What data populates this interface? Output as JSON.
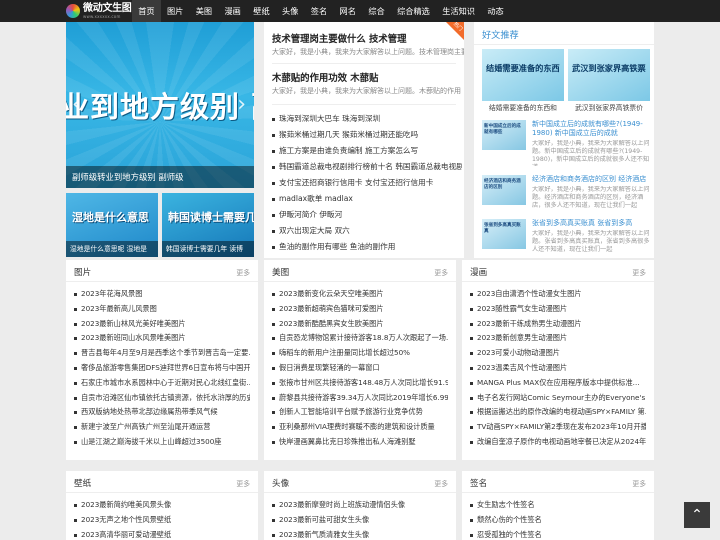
{
  "logo": {
    "title": "微动文生图网",
    "sub": "www.xxxxxx.com"
  },
  "nav": [
    "首页",
    "图片",
    "美图",
    "漫画",
    "壁纸",
    "头像",
    "签名",
    "网名",
    "综合",
    "综合精选",
    "生活知识",
    "动态"
  ],
  "slider": {
    "big_text": "业到地方级别 副",
    "caption": "副师级转业到地方级别 副师级"
  },
  "thumbs": [
    {
      "big": "湿地是什么意思",
      "caption": "湿地是什么意思呢 湿地是"
    },
    {
      "big": "韩国读博士需要几",
      "caption": "韩国读博士需要几年 读博"
    }
  ],
  "mid": {
    "corner_label": "热门",
    "headline1": "技术管理岗主要做什么 技术管理",
    "summary1": "大家好，我是小典，我来为大家解答以上问题。技术管理岗主要",
    "headline2": "木蔀贴的作用功效 木蔀贴",
    "summary2": "大家好，我是小典，我来为大家解答以上问题。木蔀贴的作用",
    "list": [
      "珠海到深圳大巴车 珠海到深圳",
      "猴茹米桶过期几天 猴茹米桶过期还能吃吗",
      "施工方案是由谁负责编制 施工方案怎么写",
      "韩国霸道总裁电视剧排行榜前十名 韩国霸道总裁电视剧",
      "支付宝还招商银行信用卡 支付宝还招行信用卡",
      "madlax歌单 madlax",
      "伊畈河简介 伊畈河",
      "双六出现定大局 双六",
      "鱼油的副作用有哪些 鱼油的副作用"
    ]
  },
  "right": {
    "title": "好文推荐",
    "tiles": [
      {
        "big": "结婚需要准备的东西",
        "caption": "结婚需要准备的东西和"
      },
      {
        "big": "武汉到张家界高铁票",
        "caption": "武汉到张家界高铁票价"
      }
    ],
    "items": [
      {
        "img": "新中国成立后的成就有哪些",
        "title": "新中国成立后的成就有哪些?(1949-1980) 新中国成立后的成就",
        "desc": "大家好，我是小典，我来为大家解答以上问题。新中国成立后的成就有哪些?(1949-1980)，新中国成立后的成就很多人还不知道"
      },
      {
        "img": "经济酒店和商务酒店的区别",
        "title": "经济酒店和商务酒店的区别 经济酒店",
        "desc": "大家好，我是小典，我来为大家解答以上问题。经济酒店和商务酒店的区别，经济酒店，很多人还不知道，现在让我们一起"
      },
      {
        "img": "张省到多高真买账真",
        "title": "张省到多高真买账真 张省到多高",
        "desc": "大家好，我是小典，我来为大家解答以上问题。张省到多高真买账真，张省到多高很多人还不知道，现在让我们一起"
      }
    ]
  },
  "boxes_row1": [
    {
      "title": "图片",
      "more": "更多",
      "items": [
        "2023年花海风景图",
        "2023年最新高儿风景图",
        "2023最新山林风光美好唯美图片",
        "2023最新班同山水风景唯美图片",
        "晋吉县每年4月至9月是西季这个季节到晋吉岛一定要...",
        "奢侈品旅游零售集团DFS迪拜世界6日宣布将与中国开发...",
        "石家庄市城市水系园林中心于近期对民心北线红皇街...",
        "自贡市沿滩区仙市镇依托古镇资源，依托水浒厚的历史人文气息的...",
        "西双版纳地处热带北部边缘属热带季风气候",
        "新建宁波至广州高铁广州至汕尾开通运营",
        "山是江湖之巅海拔千米以上山峰超过3500座"
      ]
    },
    {
      "title": "美图",
      "more": "更多",
      "items": [
        "2023最新变化云朵天空唯美图片",
        "2023最新超萌宾色猫咪可爱图片",
        "2023最新酷酷黑宾女生欧美图片",
        "自贡恐龙博物馆累计接待游客18.8万人次跟起了一场...",
        "嗨稻车的新用户注册量同比增长超过50%",
        "假日消费星现繁轻涌的一幕窗口",
        "张掖市甘州区共接待游客148.48万人次同比增长91.96%",
        "蔚黎县共接待游客39.34万人次同比2019年增长6.99%",
        "创新人工智能培训平台赋予旅游行业竞争优势",
        "亚利桑那州VIA理费时赛暖不膨的建筑和设计质量",
        "快岸漫画翼鼻比克日珍殊推出私人海滩别墅"
      ]
    },
    {
      "title": "漫画",
      "more": "更多",
      "items": [
        "2023自由潇洒个性动漫女生图片",
        "2023随性霸气女生动漫图片",
        "2023最新干练成熟男生动漫图片",
        "2023最新创意男生动漫图片",
        "2023可爱小动物动漫图片",
        "2023温柔吉风个性动漫图片",
        "MANGA Plus MAX仅在应用程序版本中提供标准...",
        "电子名发行网站Comic Seymour主办的Everyone's C...",
        "根据运搬达出的原作改编的电视动画SPY×FAMILY 第...",
        "TV动画SPY×FAMILY第2季现在发布2023年10月开播",
        "改编自奎凉子原作的电视动画地宰餐已决定从2024年..."
      ]
    }
  ],
  "boxes_row2": [
    {
      "title": "壁纸",
      "more": "更多",
      "items": [
        "2023最新简约唯美风景头像",
        "2023无声之地个性风景壁纸",
        "2023高清华丽可爱动漫壁纸"
      ]
    },
    {
      "title": "头像",
      "more": "更多",
      "items": [
        "2023最新摩登时尚上班族动漫情侣头像",
        "2023最新可盐可甜女生头像",
        "2023最新气质清雅女生头像"
      ]
    },
    {
      "title": "签名",
      "more": "更多",
      "items": [
        "女生励志个性签名",
        "颓然心伤的个性签名",
        "忍受孤独的个性签名"
      ]
    }
  ],
  "totop": "⌃"
}
